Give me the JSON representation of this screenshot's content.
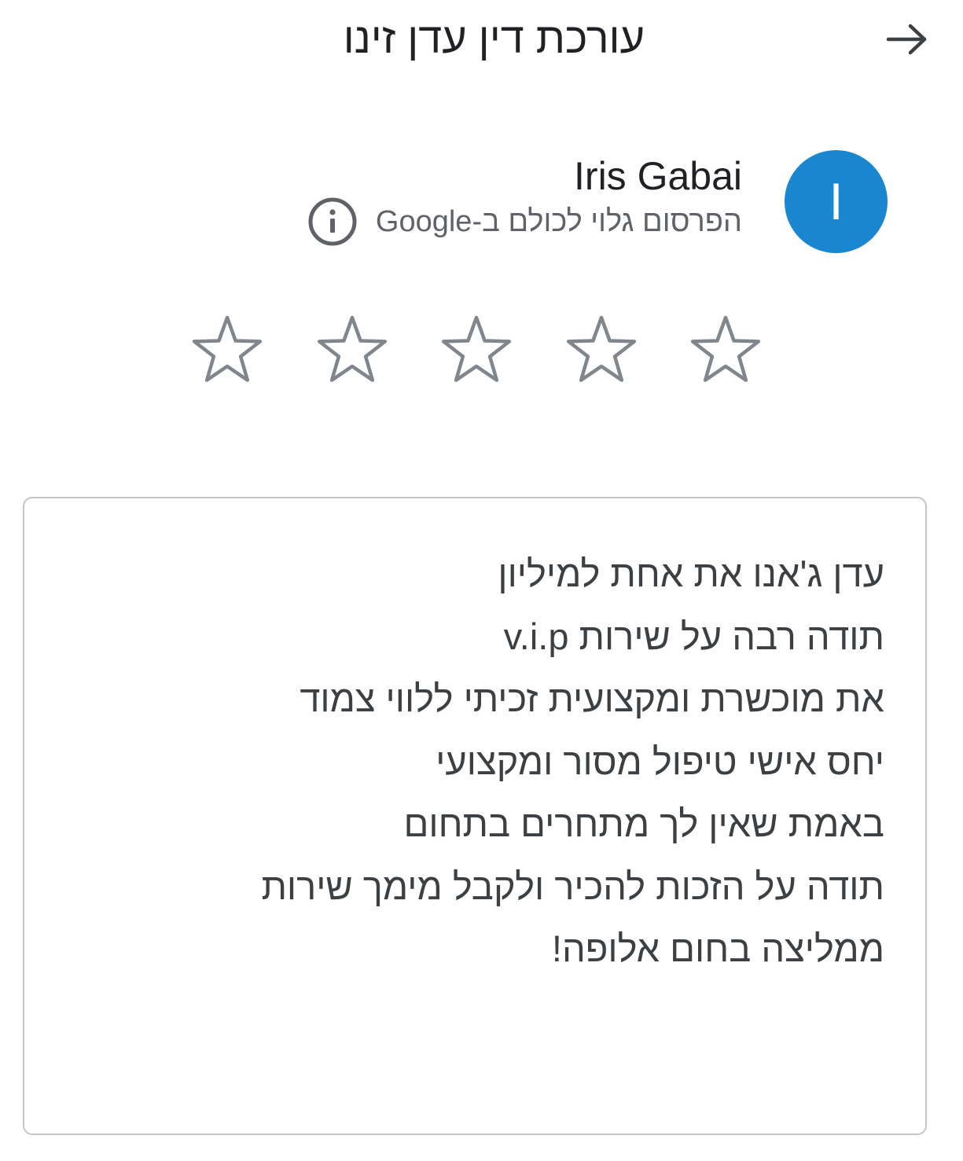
{
  "header": {
    "title": "עורכת דין עדן זינו",
    "back_icon": "arrow-right-icon"
  },
  "profile": {
    "avatar_initial": "I",
    "avatar_color": "#1a86d0",
    "name": "Iris Gabai",
    "visibility_text": "הפרסום גלוי לכולם ב-Google",
    "info_icon": "info-icon"
  },
  "rating": {
    "max_stars": 5,
    "selected": 0,
    "star_icon": "star-outline-icon",
    "star_color": "#80868b"
  },
  "review": {
    "lines": [
      "עדן ג'אנו את אחת למיליון",
      "תודה רבה על שירות v.i.p",
      "את מוכשרת ומקצועית זכיתי ללווי צמוד",
      "יחס אישי טיפול מסור ומקצועי",
      "באמת שאין לך מתחרים בתחום",
      "תודה על הזכות להכיר ולקבל מימך שירות",
      "ממליצה בחום אלופה!"
    ]
  }
}
